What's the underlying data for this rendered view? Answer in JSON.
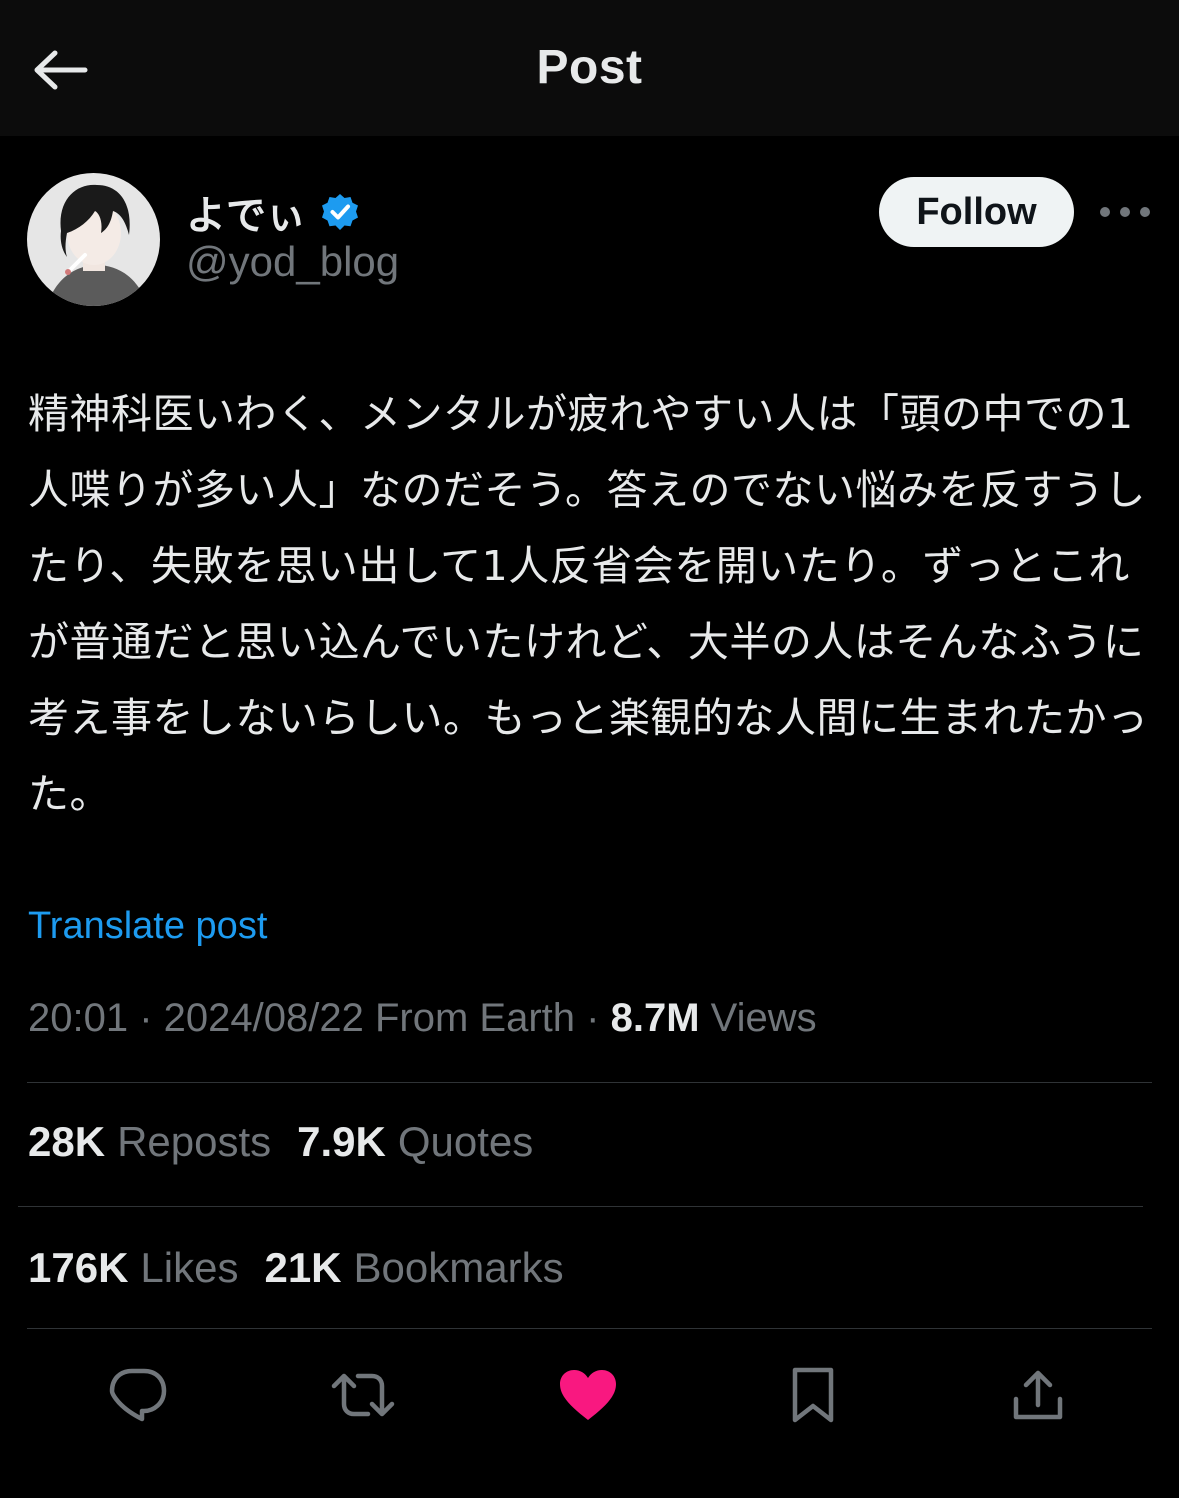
{
  "header": {
    "title": "Post"
  },
  "author": {
    "display_name": "よでぃ",
    "handle": "@yod_blog",
    "verified": true
  },
  "follow_label": "Follow",
  "post": {
    "text": "精神科医いわく、メンタルが疲れやすい人は「頭の中での1人喋りが多い人」なのだそう。答えのでない悩みを反すうしたり、失敗を思い出して1人反省会を開いたり。ずっとこれが普通だと思い込んでいたけれど、大半の人はそんなふうに考え事をしないらしい。もっと楽観的な人間に生まれたかった。",
    "translate_label": "Translate post"
  },
  "meta": {
    "time": "20:01",
    "date": "2024/08/22",
    "location": "From Earth",
    "views_count": "8.7M",
    "views_label": "Views"
  },
  "stats": {
    "reposts_count": "28K",
    "reposts_label": "Reposts",
    "quotes_count": "7.9K",
    "quotes_label": "Quotes",
    "likes_count": "176K",
    "likes_label": "Likes",
    "bookmarks_count": "21K",
    "bookmarks_label": "Bookmarks"
  },
  "actions": [
    {
      "name": "reply",
      "icon": "reply-icon"
    },
    {
      "name": "repost",
      "icon": "repost-icon"
    },
    {
      "name": "like",
      "icon": "heart-icon",
      "active": true
    },
    {
      "name": "bookmark",
      "icon": "bookmark-icon"
    },
    {
      "name": "share",
      "icon": "share-icon"
    }
  ],
  "colors": {
    "background": "#000000",
    "topbar": "#0c0c0c",
    "text": "#e7e9ea",
    "muted": "#71767b",
    "link": "#1d9bf0",
    "verified": "#1d9bf0",
    "like_active": "#f91880",
    "divider": "#2f3336"
  }
}
